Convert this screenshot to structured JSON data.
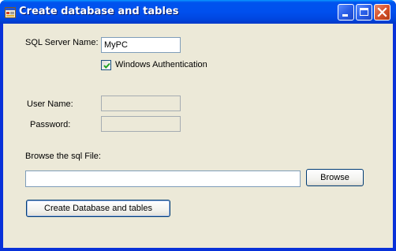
{
  "window": {
    "title": "Create database and tables",
    "icon": "app-form-icon",
    "controls": [
      "minimize-icon",
      "maximize-icon",
      "close-icon"
    ]
  },
  "form": {
    "server_label": "SQL Server Name:",
    "server_value": "MyPC",
    "windows_auth_label": "Windows Authentication",
    "windows_auth_checked": true,
    "username_label": "User Name:",
    "username_value": "",
    "password_label": "Password:",
    "password_value": "",
    "browse_label": "Browse the sql File:",
    "file_path_value": "",
    "browse_button": "Browse",
    "create_button": "Create Database and tables"
  },
  "colors": {
    "titlebar": "#0054e3",
    "client_bg": "#ece9d8",
    "checkmark": "#21a121",
    "close_button": "#d8532c"
  }
}
